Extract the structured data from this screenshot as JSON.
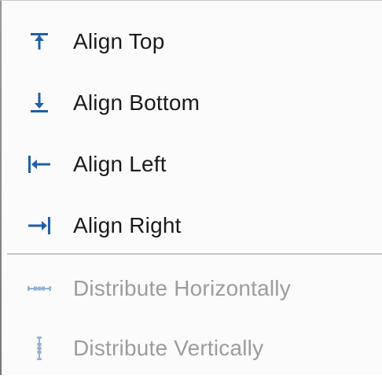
{
  "menu": {
    "items": [
      {
        "label": "Align Top",
        "icon": "align-top-icon",
        "enabled": true
      },
      {
        "label": "Align Bottom",
        "icon": "align-bottom-icon",
        "enabled": true
      },
      {
        "label": "Align Left",
        "icon": "align-left-icon",
        "enabled": true
      },
      {
        "label": "Align Right",
        "icon": "align-right-icon",
        "enabled": true
      },
      {
        "label": "Distribute Horizontally",
        "icon": "distribute-horizontally-icon",
        "enabled": false
      },
      {
        "label": "Distribute Vertically",
        "icon": "distribute-vertically-icon",
        "enabled": false
      }
    ]
  },
  "colors": {
    "icon_accent": "#1f5fa8",
    "icon_disabled": "#8fb0d6",
    "text": "#1a1a1a",
    "text_disabled": "#9c9c9c"
  }
}
